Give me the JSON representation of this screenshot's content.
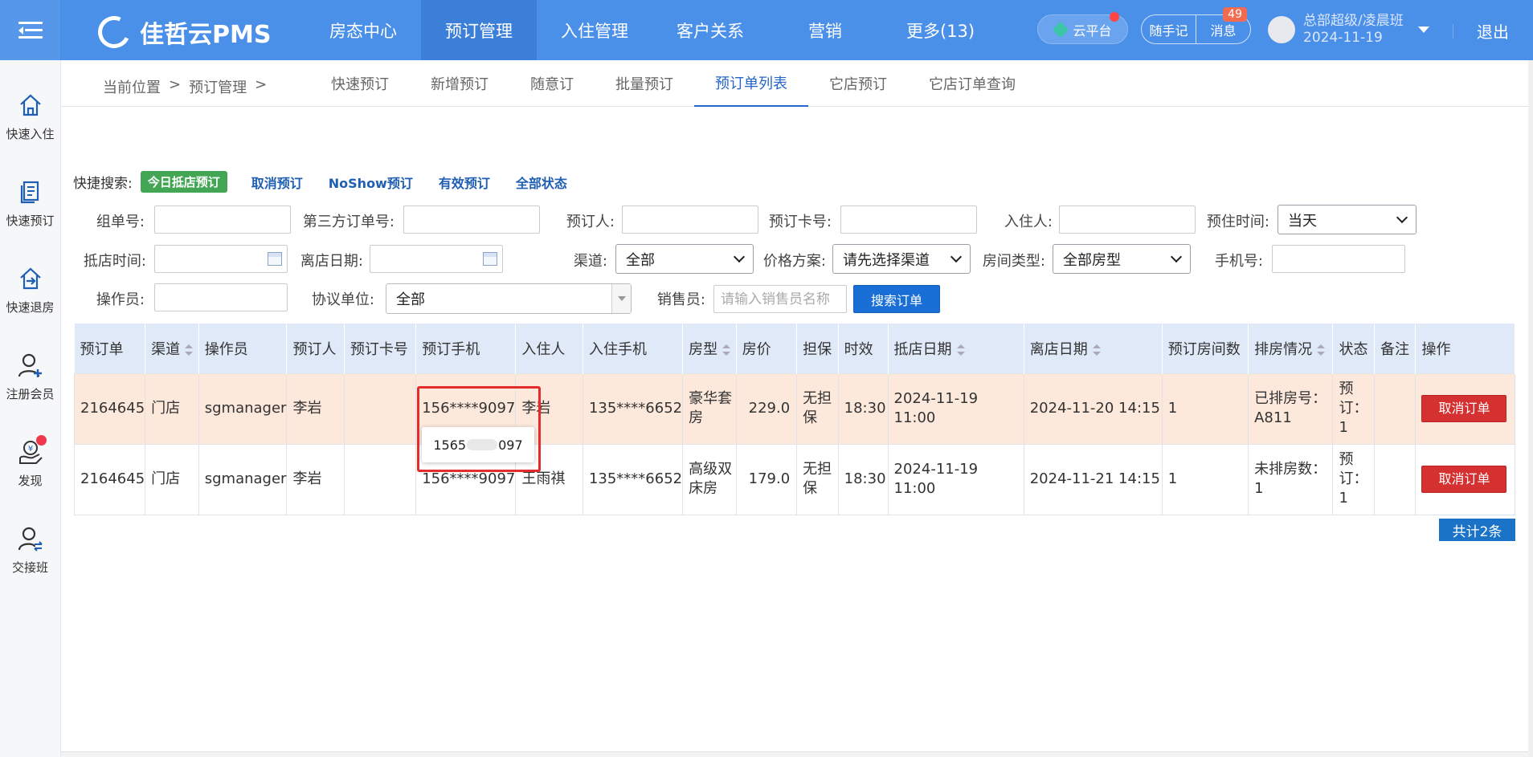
{
  "app": {
    "name": "佳哲云PMS"
  },
  "topnav": [
    {
      "label": "房态中心"
    },
    {
      "label": "预订管理",
      "active": true
    },
    {
      "label": "入住管理"
    },
    {
      "label": "客户关系"
    },
    {
      "label": "营销"
    },
    {
      "label": "更多(13)"
    }
  ],
  "header": {
    "cloud_label": "云平台",
    "notes_label": "随手记",
    "messages_label": "消息",
    "messages_count": "49",
    "user_name": "总部超级/凌晨班",
    "user_date": "2024-11-19",
    "logout_label": "退出"
  },
  "sidebar": [
    {
      "label": "快速入住",
      "icon": "house-icon"
    },
    {
      "label": "快速预订",
      "icon": "document-icon"
    },
    {
      "label": "快速退房",
      "icon": "checkout-icon"
    },
    {
      "label": "注册会员",
      "icon": "add-user-icon"
    },
    {
      "label": "发现",
      "icon": "discover-icon"
    },
    {
      "label": "交接班",
      "icon": "handover-icon"
    }
  ],
  "breadcrumb": [
    "当前位置",
    ">",
    "预订管理",
    ">"
  ],
  "tabs": [
    {
      "label": "快速预订"
    },
    {
      "label": "新增预订"
    },
    {
      "label": "随意订"
    },
    {
      "label": "批量预订"
    },
    {
      "label": "预订单列表",
      "active": true
    },
    {
      "label": "它店预订"
    },
    {
      "label": "它店订单查询"
    }
  ],
  "quick_search": {
    "label": "快捷搜索:",
    "chip": "今日抵店预订",
    "links": [
      "取消预订",
      "NoShow预订",
      "有效预订",
      "全部状态"
    ]
  },
  "form": {
    "group_no": "组单号:",
    "third_party_no": "第三方订单号:",
    "booker": "预订人:",
    "booking_card": "预订卡号:",
    "guest": "入住人:",
    "stay_time": "预住时间:",
    "stay_time_value": "当天",
    "arrival_time": "抵店时间:",
    "departure_date": "离店日期:",
    "channel": "渠道:",
    "channel_value": "全部",
    "price_plan": "价格方案:",
    "price_plan_value": "请先选择渠道",
    "room_type": "房间类型:",
    "room_type_value": "全部房型",
    "phone": "手机号:",
    "operator": "操作员:",
    "agreement": "协议单位:",
    "agreement_value": "全部",
    "salesperson": "销售员:",
    "salesperson_placeholder": "请输入销售员名称",
    "search_button": "搜索订单"
  },
  "table": {
    "headers": [
      "预订单",
      "渠道",
      "操作员",
      "预订人",
      "预订卡号",
      "预订手机",
      "入住人",
      "入住手机",
      "房型",
      "房价",
      "担保",
      "时效",
      "抵店日期",
      "离店日期",
      "预订房间数",
      "排房情况",
      "状态",
      "备注",
      "操作"
    ],
    "rows": [
      {
        "order": "2164645",
        "channel": "门店",
        "operator": "sgmanager",
        "booker": "李岩",
        "card": "",
        "booker_phone": "156****9097",
        "guest": "李岩",
        "guest_phone": "135****6652",
        "room_type": "豪华套房",
        "price": "229.0",
        "guarantee": "无担保",
        "timing": "18:30",
        "arrival": "2024-11-19 11:00",
        "departure": "2024-11-20 14:15",
        "rooms": "1",
        "assignment": "已排房号：A811",
        "status": "预订：1",
        "remark": "",
        "action": "取消订单"
      },
      {
        "order": "2164645",
        "channel": "门店",
        "operator": "sgmanager",
        "booker": "李岩",
        "card": "",
        "booker_phone": "156****9097",
        "guest": "王雨祺",
        "guest_phone": "135****6652",
        "room_type": "高级双床房",
        "price": "179.0",
        "guarantee": "无担保",
        "timing": "18:30",
        "arrival": "2024-11-19 11:00",
        "departure": "2024-11-21 14:15",
        "rooms": "1",
        "assignment": "未排房数：1",
        "status": "预订：1",
        "remark": "",
        "action": "取消订单"
      }
    ],
    "total": "共计2条"
  },
  "tooltip": {
    "prefix": "1565",
    "suffix": "097"
  },
  "colors": {
    "topbar": "#4a8fe8",
    "accent": "#2566c9",
    "cancel": "#d63131",
    "row_highlight": "#fde8dc"
  }
}
